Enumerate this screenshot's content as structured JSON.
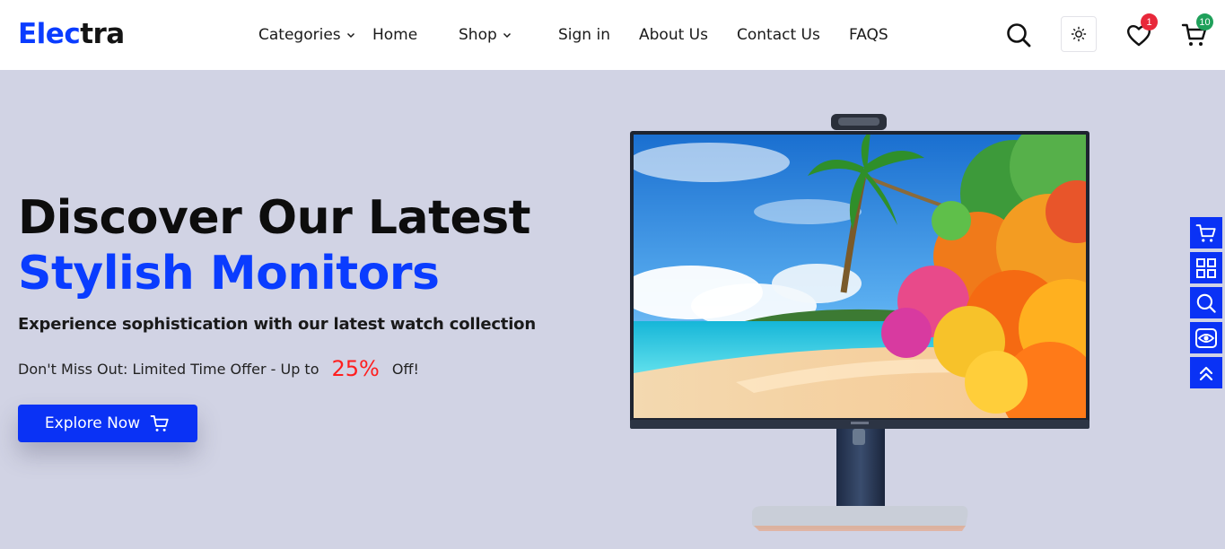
{
  "brand": {
    "name_part1": "Elec",
    "name_part2": "tra",
    "accent_color": "#0a3cff"
  },
  "nav": {
    "items": [
      {
        "label": "Categories",
        "dropdown": true
      },
      {
        "label": "Home",
        "dropdown": false
      },
      {
        "label": "Shop",
        "dropdown": true
      },
      {
        "label": "Sign in",
        "dropdown": false
      },
      {
        "label": "About Us",
        "dropdown": false
      },
      {
        "label": "Contact Us",
        "dropdown": false
      },
      {
        "label": "FAQS",
        "dropdown": false
      }
    ]
  },
  "header_icons": {
    "search": "search-icon",
    "theme": "sun-icon",
    "wishlist": {
      "icon": "heart-icon",
      "count": "1",
      "badge_color": "#e8283a"
    },
    "cart": {
      "icon": "cart-icon",
      "count": "10",
      "badge_color": "#1fa05a"
    }
  },
  "hero": {
    "title_line1": "Discover Our Latest",
    "title_line2": "Stylish Monitors",
    "subtitle": "Experience sophistication with our latest watch collection",
    "offer_prefix": "Don't Miss Out: Limited Time Offer - Up to",
    "offer_percent": "25%",
    "offer_suffix": "Off!",
    "cta_label": "Explore Now",
    "cta_icon": "cart-icon"
  },
  "side_toolbar": {
    "items": [
      {
        "icon": "cart-icon"
      },
      {
        "icon": "grid-icon"
      },
      {
        "icon": "search-icon"
      },
      {
        "icon": "eye-icon"
      },
      {
        "icon": "double-chevron-up-icon"
      }
    ]
  },
  "colors": {
    "hero_bg": "#d1d3e4",
    "primary": "#0a32f5",
    "offer_highlight": "#ff1e1e"
  }
}
